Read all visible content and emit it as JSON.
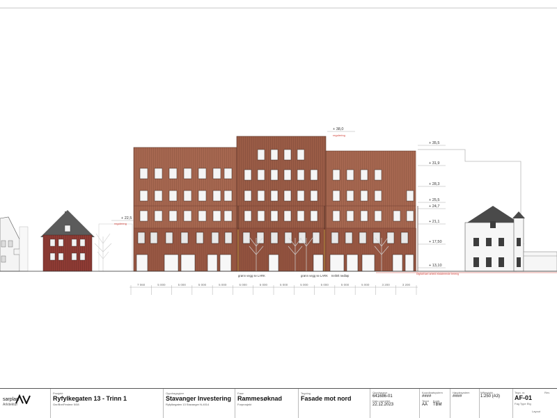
{
  "elevation": {
    "levels": [
      {
        "label": "+ 38,0",
        "note": "regulering"
      },
      {
        "label": "+ 35,5"
      },
      {
        "label": "+ 31,9"
      },
      {
        "label": "+ 28,3"
      },
      {
        "label": "+ 25,5"
      },
      {
        "label": "+ 24,7"
      },
      {
        "label": "+ 22,5",
        "note": "regulering"
      },
      {
        "label": "+ 21,1"
      },
      {
        "label": "+ 17,50"
      },
      {
        "label": "+ 13,10"
      }
    ],
    "dimensions": [
      "7 060",
      "5 000",
      "5 000",
      "5 000",
      "5 000",
      "5 000",
      "5 000",
      "5 000",
      "5 000",
      "5 000",
      "5 000",
      "5 000",
      "3 200",
      "3 200"
    ],
    "annotations": {
      "wall_1": "grønn vegg se LARK",
      "wall_2": "grønn vegg se LARK",
      "entrance": "Innfelt nedløp",
      "terrain": "Digitalt kart arbeid eksisterende terreng"
    }
  },
  "title_block": {
    "company_line1": "sarplan",
    "company_line2": "Arkitektur",
    "project_label": "Prosjekt",
    "project": "Ryfylkegaten 13 - Trinn 1",
    "project_sub": "Gnr/Bnr/Festenr 5/08",
    "client_label": "Oppdragsgiver",
    "client": "Stavanger Investering",
    "client_sub": "Ryfylkegaten 13 Stavanger N-4014",
    "phase_label": "Fase",
    "phase": "Rammesøknad",
    "phase_sub": "Forprosjekt",
    "drawing_label": "Tegning",
    "drawing": "Fasade mot nord",
    "job_no_label": "Oppdragsnr.",
    "job_no": "641686-01",
    "date_label": "Dato opprettet",
    "date": "22.12.2023",
    "coord_label": "Koordinatsystem",
    "coord": "####",
    "drawn_label": "Tegnt",
    "drawn": "AA",
    "checked_label": "Kontr.",
    "checked": "TBM",
    "height_label": "Høydesystem",
    "height": "####",
    "scale_label": "Målestokk",
    "scale": "1:250 (A3)",
    "sheet_label": "Tegn. nr.",
    "sheet": "AF-01",
    "sheet_sub": "Fag Type Etg",
    "rev_label": "Rev.",
    "layout_label": "Layout"
  }
}
